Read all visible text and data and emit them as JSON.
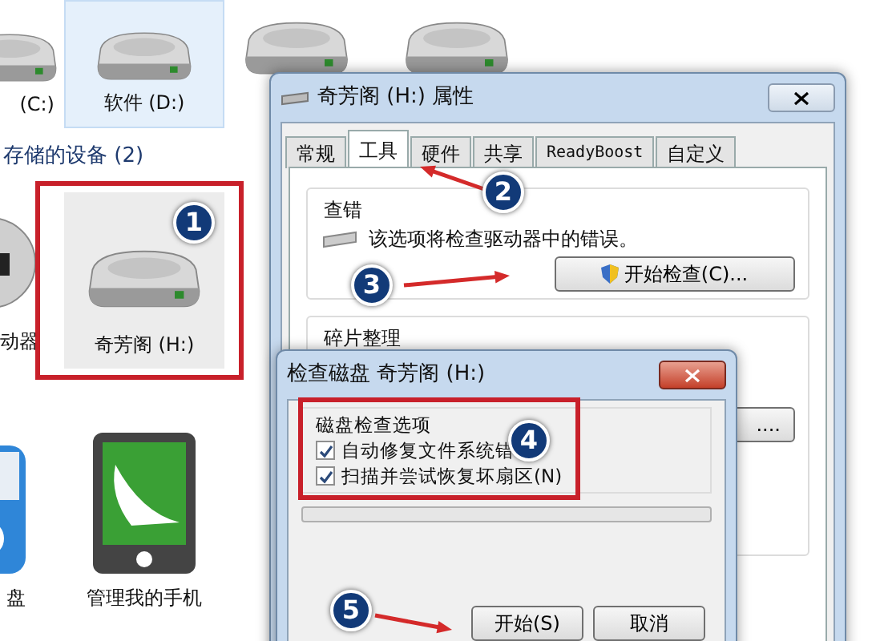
{
  "explorer": {
    "drives": [
      {
        "label": "(C:)",
        "selected": false
      },
      {
        "label": "软件 (D:)",
        "selected": true
      }
    ],
    "section_header": "存储的设备 (2)",
    "devices": [
      {
        "label": "动器",
        "kind": "dvd"
      },
      {
        "label": "奇芳阁 (H:)",
        "kind": "drive"
      }
    ],
    "other_items": [
      {
        "label": "盘",
        "kind": "cloud"
      },
      {
        "label": "管理我的手机",
        "kind": "phone"
      }
    ]
  },
  "properties_window": {
    "title": "奇芳阁 (H:) 属性",
    "tabs": [
      {
        "label": "常规",
        "selected": false
      },
      {
        "label": "工具",
        "selected": true
      },
      {
        "label": "硬件",
        "selected": false
      },
      {
        "label": "共享",
        "selected": false
      },
      {
        "label": "ReadyBoost",
        "selected": false
      },
      {
        "label": "自定义",
        "selected": false
      }
    ],
    "error_checking": {
      "title": "查错",
      "description": "该选项将检查驱动器中的错误。",
      "button": "开始检查(C)..."
    },
    "defrag": {
      "title": "碎片整理",
      "button": "...."
    }
  },
  "check_disk_dialog": {
    "title": "检查磁盘 奇芳阁 (H:)",
    "group_title": "磁盘检查选项",
    "options": [
      {
        "label": "自动修复文件系统错",
        "checked": true
      },
      {
        "label": "扫描并尝试恢复坏扇区(N)",
        "checked": true
      }
    ],
    "progress": {
      "level": 0
    },
    "buttons": [
      "开始(S)",
      "取消"
    ]
  },
  "annotations": [
    "1",
    "2",
    "3",
    "4",
    "5"
  ]
}
